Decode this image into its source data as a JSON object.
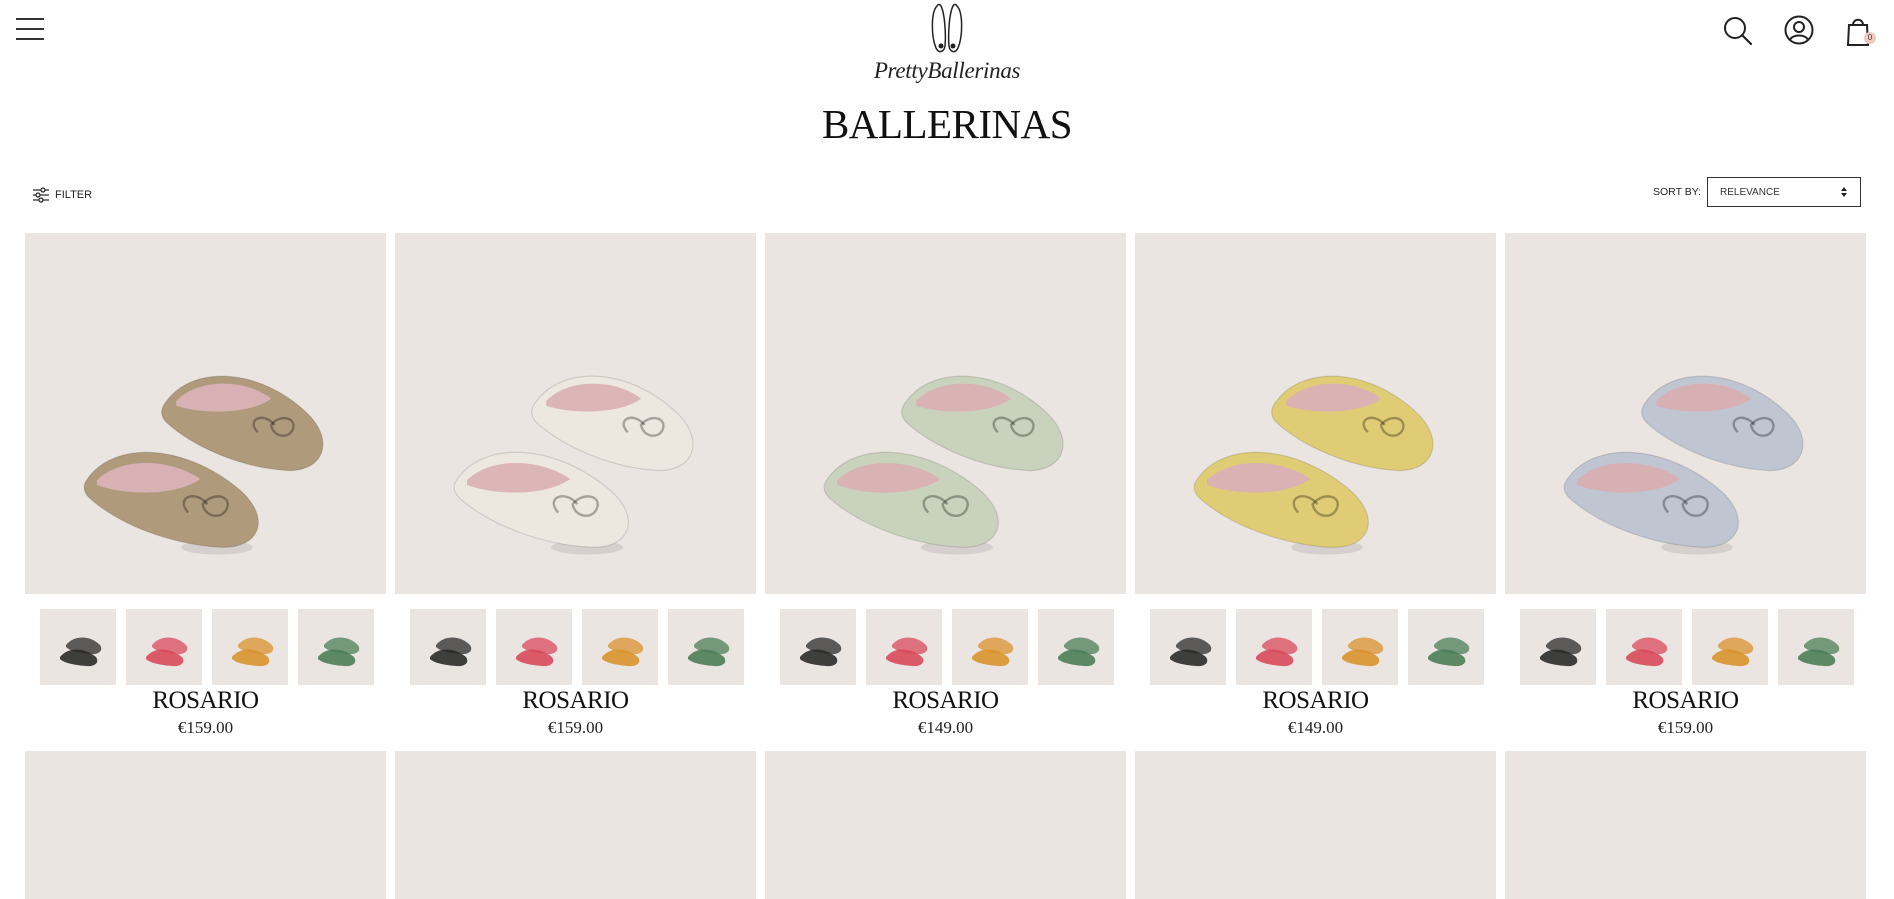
{
  "header": {
    "brand": "PrettyBallerinas",
    "menu_icon": "hamburger-menu-icon",
    "search_icon": "search-icon",
    "account_icon": "user-icon",
    "cart_icon": "shopping-bag-icon",
    "cart_count": "0"
  },
  "page": {
    "title": "BALLERINAS"
  },
  "toolbar": {
    "filter_label": "FILTER",
    "filter_icon": "sliders-icon",
    "sort_label": "SORT BY:",
    "sort_value": "RELEVANCE",
    "sort_icon": "up-down-arrows-icon"
  },
  "swatch_colors": [
    "#2b2b2b",
    "#d94a5c",
    "#d9922e",
    "#4c7d57"
  ],
  "products": [
    {
      "name": "ROSARIO",
      "price": "€159.00",
      "color": "#b09a7c",
      "lining": "#d8b1b4"
    },
    {
      "name": "ROSARIO",
      "price": "€159.00",
      "color": "#ece8e0",
      "lining": "#dcb5b7"
    },
    {
      "name": "ROSARIO",
      "price": "€149.00",
      "color": "#c9d2bd",
      "lining": "#d9b2b4"
    },
    {
      "name": "ROSARIO",
      "price": "€149.00",
      "color": "#e0cc74",
      "lining": "#dbb2b3"
    },
    {
      "name": "ROSARIO",
      "price": "€159.00",
      "color": "#bfc6d2",
      "lining": "#d7b0b4"
    }
  ]
}
